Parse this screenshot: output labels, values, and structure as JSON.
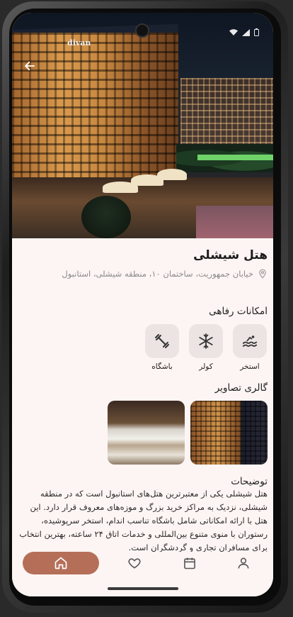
{
  "hotel": {
    "name": "هتل شیشلی",
    "address": "خیابان جمهوریت، ساختمان ۱۰، منطقه شیشلی، استانبول",
    "logo_text": "divan"
  },
  "amenities": {
    "title": "امکانات رفاهی",
    "items": [
      {
        "label": "استخر",
        "icon": "pool-icon"
      },
      {
        "label": "کولر",
        "icon": "snowflake-icon"
      },
      {
        "label": "باشگاه",
        "icon": "dumbbell-icon"
      }
    ]
  },
  "gallery": {
    "title": "گالری تصاویر"
  },
  "description": {
    "title": "توضیحات",
    "text": "هتل شیشلی یکی از معتبرترین هتل‌های استانبول است که در منطقه شیشلی، نزدیک به مراکز خرید بزرگ و موزه‌های معروف قرار دارد. این هتل با ارائه امکاناتی شامل باشگاه تناسب اندام، استخر سرپوشیده، رستوران با منوی متنوع بین‌المللی و خدمات اتاق ۲۴ ساعته، بهترین انتخاب برای مسافران تجاری و گردشگران است."
  },
  "nav": {
    "items": [
      "home-icon",
      "heart-icon",
      "calendar-icon",
      "person-icon"
    ],
    "active": "home-icon"
  },
  "colors": {
    "accent": "#b56f59",
    "background": "#fdf5f3",
    "amenity_bg": "#ebe4e2"
  }
}
